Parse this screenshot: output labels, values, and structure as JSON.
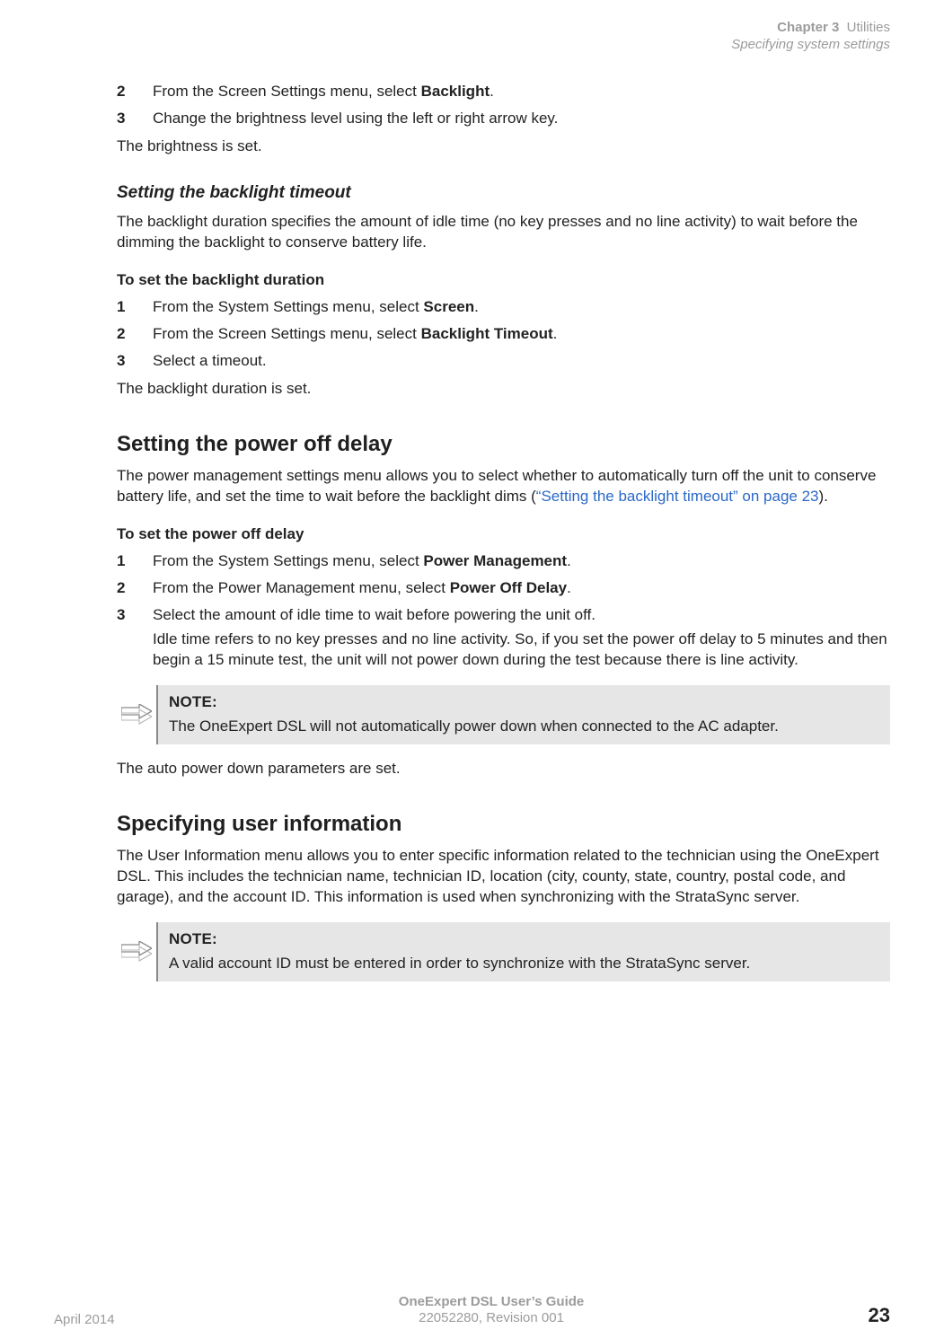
{
  "header": {
    "chapter": "Chapter 3",
    "title": "Utilities",
    "subtitle": "Specifying system settings"
  },
  "steps_top": [
    {
      "n": "2",
      "pre": "From the Screen Settings menu, select ",
      "bold": "Backlight",
      "post": "."
    },
    {
      "n": "3",
      "pre": "Change the brightness level using the left or right arrow key.",
      "bold": "",
      "post": ""
    }
  ],
  "top_result": "The brightness is set.",
  "section_timeout": {
    "heading": "Setting the backlight timeout",
    "intro": "The backlight duration specifies the amount of idle time (no key presses and no line activity) to wait before the dimming the backlight to conserve battery life.",
    "task": "To set the backlight duration",
    "steps": [
      {
        "n": "1",
        "pre": "From the System Settings menu, select ",
        "bold": "Screen",
        "post": "."
      },
      {
        "n": "2",
        "pre": "From the Screen Settings menu, select ",
        "bold": "Backlight Timeout",
        "post": "."
      },
      {
        "n": "3",
        "pre": "Select a timeout.",
        "bold": "",
        "post": ""
      }
    ],
    "result": "The backlight duration is set."
  },
  "section_power": {
    "heading": "Setting the power off delay",
    "intro_pre": "The power management settings menu allows you to select whether to automatically turn off the unit to conserve battery life, and set the time to wait before the backlight dims (",
    "intro_xref": "“Setting the backlight timeout” on page 23",
    "intro_post": ").",
    "task": "To set the power off delay",
    "steps": [
      {
        "n": "1",
        "pre": "From the System Settings menu, select ",
        "bold": "Power Management",
        "post": "."
      },
      {
        "n": "2",
        "pre": "From the Power Management menu, select ",
        "bold": "Power Off Delay",
        "post": "."
      },
      {
        "n": "3",
        "pre": "Select the amount of idle time to wait before powering the unit off.",
        "bold": "",
        "post": ""
      }
    ],
    "step3_sub": "Idle time refers to no key presses and no line activity. So, if you set the power off delay to 5 minutes and then begin a 15 minute test, the unit will not power down during the test because there is line activity.",
    "note_label": "NOTE:",
    "note_text": "The OneExpert DSL will not automatically power down when connected to the AC adapter.",
    "result": "The auto power down parameters are set."
  },
  "section_user": {
    "heading": "Specifying user information",
    "intro": "The User Information menu allows you to enter specific information related to the technician using the OneExpert DSL. This includes the technician name, technician ID, location (city, county, state, country, postal code, and garage), and the account ID. This information is used when synchronizing with the StrataSync server.",
    "note_label": "NOTE:",
    "note_text": "A valid account ID must be entered in order to synchronize with the StrataSync server."
  },
  "footer": {
    "left": "April 2014",
    "center_line1": "OneExpert DSL User’s Guide",
    "center_line2": "22052280, Revision 001",
    "page": "23"
  }
}
